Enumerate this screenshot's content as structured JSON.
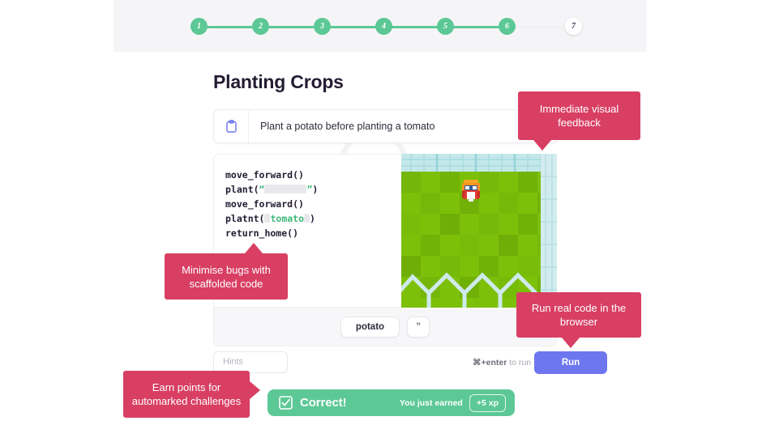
{
  "header": {
    "steps": [
      {
        "label": "1",
        "state": "done"
      },
      {
        "label": "2",
        "state": "done"
      },
      {
        "label": "3",
        "state": "done"
      },
      {
        "label": "4",
        "state": "done"
      },
      {
        "label": "5",
        "state": "done"
      },
      {
        "label": "6",
        "state": "done"
      },
      {
        "label": "7",
        "state": "current"
      }
    ]
  },
  "page": {
    "title": "Planting Crops"
  },
  "instruction": {
    "icon": "clipboard-icon",
    "text": "Plant a potato before planting a tomato"
  },
  "editor": {
    "lines": [
      {
        "id": "l1",
        "prefix": "move_forward()",
        "kind": "plain"
      },
      {
        "id": "l2",
        "prefix": "plant(",
        "quote_open": "“",
        "slot": "blank-wide",
        "quote_close": "”",
        "suffix": ")",
        "kind": "blank-string"
      },
      {
        "id": "l3",
        "prefix": "move_forward()",
        "kind": "plain"
      },
      {
        "id": "l4",
        "prefix": "platnt(",
        "slot_left": " ",
        "value": "tomato",
        "slot_right": " ",
        "suffix": ")",
        "kind": "filled-string"
      },
      {
        "id": "l5",
        "prefix": "return_home()",
        "kind": "plain"
      }
    ]
  },
  "chips": [
    {
      "label": "potato",
      "name": "answer-chip-potato"
    },
    {
      "label": "”",
      "name": "answer-chip-quote"
    }
  ],
  "controls": {
    "hints_placeholder": "Hints",
    "run_shortcut_key": "⌘+enter",
    "run_shortcut_tail": " to run",
    "run_label": "Run"
  },
  "toast": {
    "icon": "check-square-icon",
    "title": "Correct!",
    "earned_label": "You just earned",
    "xp_badge": "+5 xp"
  },
  "callouts": [
    {
      "id": "visual-feedback",
      "text": "Immediate visual feedback",
      "tail": "down"
    },
    {
      "id": "scaffolded-code",
      "text": "Minimise bugs with scaffolded code",
      "tail": "up"
    },
    {
      "id": "run-real-code",
      "text": "Run real code in the browser",
      "tail": "down"
    },
    {
      "id": "earn-points",
      "text": "Earn points for automarked challenges",
      "tail": "right"
    }
  ],
  "colors": {
    "accent_green": "#5cc896",
    "callout_pink": "#d83f63",
    "run_blue": "#6d76ee",
    "header_bg": "#f5f5f7",
    "title_ink": "#241c33",
    "grass": "#7cc00a",
    "fence": "#bde7ea"
  }
}
